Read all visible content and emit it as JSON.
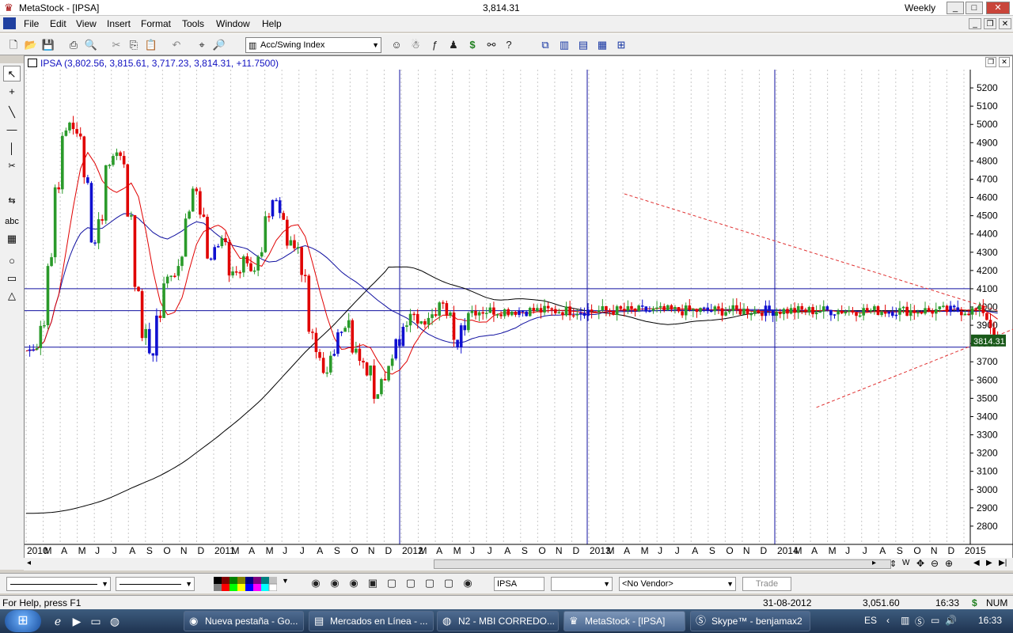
{
  "window": {
    "app_title": "MetaStock - [IPSA]",
    "center_value": "3,814.31",
    "period": "Weekly"
  },
  "menu": [
    "File",
    "Edit",
    "View",
    "Insert",
    "Format",
    "Tools",
    "Window",
    "Help"
  ],
  "toolbar": {
    "indicator_select": "Acc/Swing Index"
  },
  "chart_header": {
    "label": "IPSA (3,802.56, 3,815.61, 3,717.23, 3,814.31, +11.7500)"
  },
  "chart_data": {
    "type": "candlestick",
    "security": "IPSA",
    "ohlc": [
      3802.56,
      3815.61,
      3717.23,
      3814.31
    ],
    "change": 11.75,
    "last_value_label": "3814.31",
    "ylim": [
      2700,
      5300
    ],
    "y_ticks": [
      2800,
      2900,
      3000,
      3100,
      3200,
      3300,
      3400,
      3500,
      3600,
      3700,
      3800,
      3900,
      4000,
      4100,
      4200,
      4300,
      4400,
      4500,
      4600,
      4700,
      4800,
      4900,
      5000,
      5100,
      5200
    ],
    "x_labels": [
      "2010",
      "M",
      "A",
      "M",
      "J",
      "J",
      "A",
      "S",
      "O",
      "N",
      "D",
      "2011",
      "M",
      "A",
      "M",
      "J",
      "J",
      "A",
      "S",
      "O",
      "N",
      "D",
      "2012",
      "M",
      "A",
      "M",
      "J",
      "J",
      "A",
      "S",
      "O",
      "N",
      "D",
      "2013",
      "M",
      "A",
      "M",
      "J",
      "J",
      "A",
      "S",
      "O",
      "N",
      "D",
      "2014",
      "M",
      "A",
      "M",
      "J",
      "J",
      "A",
      "S",
      "O",
      "N",
      "D",
      "2015"
    ],
    "close_path": [
      [
        0,
        3760
      ],
      [
        4,
        3790
      ],
      [
        8,
        3900
      ],
      [
        12,
        4250
      ],
      [
        16,
        4650
      ],
      [
        20,
        4950
      ],
      [
        22,
        5000
      ],
      [
        24,
        4950
      ],
      [
        26,
        4700
      ],
      [
        28,
        4350
      ],
      [
        30,
        4500
      ],
      [
        32,
        4750
      ],
      [
        34,
        4850
      ],
      [
        36,
        4800
      ],
      [
        38,
        4500
      ],
      [
        40,
        4100
      ],
      [
        42,
        3850
      ],
      [
        44,
        3750
      ],
      [
        46,
        3950
      ],
      [
        48,
        4150
      ],
      [
        50,
        4180
      ],
      [
        52,
        4250
      ],
      [
        54,
        4500
      ],
      [
        56,
        4650
      ],
      [
        58,
        4500
      ],
      [
        60,
        4250
      ],
      [
        62,
        4350
      ],
      [
        64,
        4380
      ],
      [
        66,
        4200
      ],
      [
        68,
        4180
      ],
      [
        70,
        4250
      ],
      [
        72,
        4200
      ],
      [
        74,
        4280
      ],
      [
        76,
        4500
      ],
      [
        78,
        4600
      ],
      [
        80,
        4500
      ],
      [
        82,
        4350
      ],
      [
        84,
        4300
      ],
      [
        86,
        4150
      ],
      [
        88,
        3850
      ],
      [
        90,
        3750
      ],
      [
        92,
        3650
      ],
      [
        94,
        3750
      ],
      [
        96,
        3850
      ],
      [
        98,
        3900
      ],
      [
        100,
        3780
      ],
      [
        102,
        3700
      ],
      [
        104,
        3650
      ],
      [
        106,
        3500
      ],
      [
        108,
        3600
      ],
      [
        110,
        3700
      ],
      [
        112,
        3800
      ],
      [
        114,
        3920
      ],
      [
        116,
        3950
      ],
      [
        118,
        3900
      ],
      [
        120,
        3920
      ],
      [
        122,
        3980
      ],
      [
        124,
        4050
      ],
      [
        126,
        3950
      ],
      [
        128,
        3800
      ],
      [
        130,
        3900
      ],
      [
        132,
        3980
      ],
      [
        134,
        3814
      ]
    ],
    "moving_averages": [
      {
        "color": "#e00000",
        "lag": 3
      },
      {
        "color": "#1010a0",
        "lag": 15
      },
      {
        "color": "#000000",
        "lag": 45
      }
    ],
    "horizontal_lines": [
      4100,
      3980,
      3780
    ],
    "vertical_line_labels": [
      "2012",
      "2013",
      "2014"
    ],
    "trendlines": [
      {
        "from": [
          "2013-03",
          4620
        ],
        "to": [
          "2014-12",
          3980
        ]
      },
      {
        "from": [
          "2014-02",
          3450
        ],
        "to": [
          "2014-12",
          3900
        ]
      }
    ]
  },
  "draw_toolbar": {
    "security_input": "IPSA",
    "vendor_select": "<No Vendor>",
    "trade_button": "Trade"
  },
  "status_bar": {
    "help": "For Help, press F1",
    "date": "31-08-2012",
    "value": "3,051.60",
    "time": "16:33",
    "dollar": "$",
    "num": "NUM"
  },
  "taskbar": {
    "tasks": [
      {
        "label": "Nueva pestaña - Go...",
        "icon": "chrome-icon"
      },
      {
        "label": "Mercados en Línea - ...",
        "icon": "document-icon"
      },
      {
        "label": "N2 - MBI CORREDO...",
        "icon": "firefox-icon"
      },
      {
        "label": "MetaStock - [IPSA]",
        "icon": "metastock-icon"
      },
      {
        "label": "Skype™ - benjamax2",
        "icon": "skype-icon"
      }
    ],
    "lang": "ES",
    "clock": "16:33"
  },
  "colors": {
    "up_candle": "#2a9a2a",
    "down_candle": "#e00000",
    "neutral_candle": "#1010d0",
    "grid_line": "#1010a0",
    "trendline": "#e03030"
  }
}
